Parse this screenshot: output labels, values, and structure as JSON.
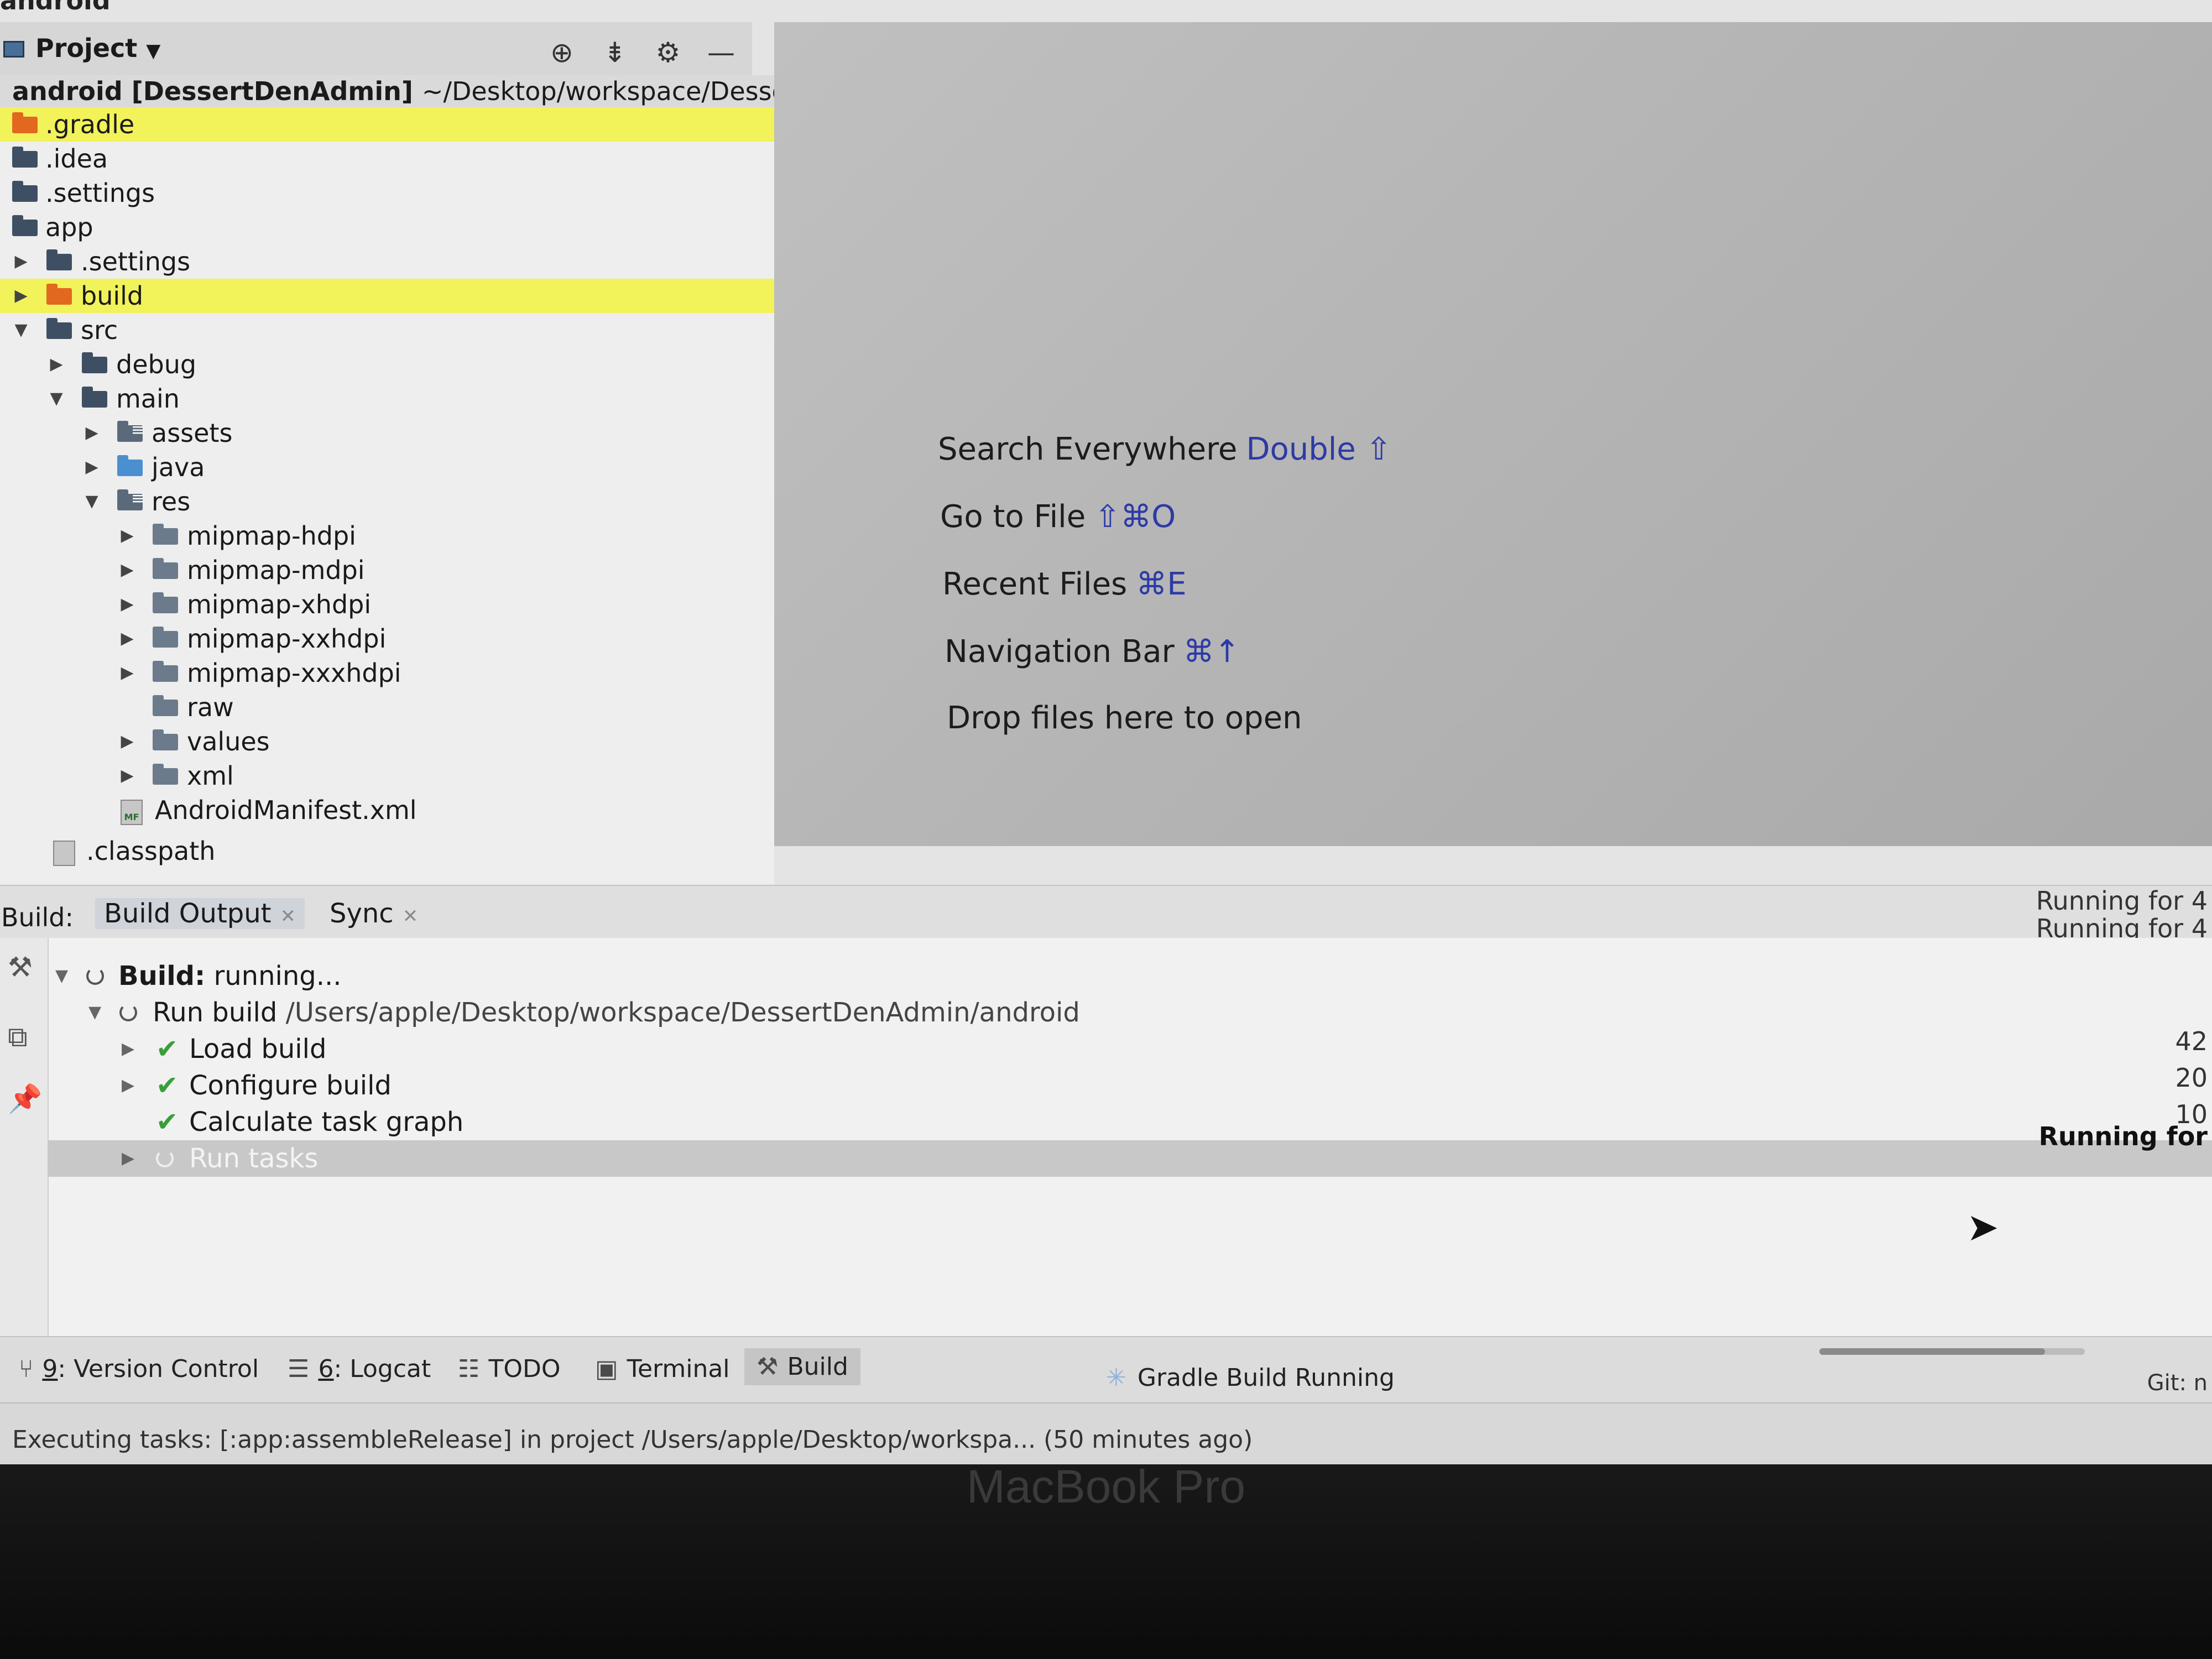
{
  "app_label": "android",
  "project_panel": {
    "title": "Project",
    "caret": "▼",
    "tools": [
      "⊕",
      "⇟",
      "⚙",
      "—"
    ],
    "root_name": "android [DessertDenAdmin]",
    "root_path": "~/Desktop/workspace/DessertDenAdmin/android",
    "items": [
      {
        "label": ".gradle",
        "highlight": true
      },
      {
        "label": ".idea"
      },
      {
        "label": ".settings"
      },
      {
        "label": "app"
      },
      {
        "label": ".settings"
      },
      {
        "label": "build",
        "highlight": true
      },
      {
        "label": "src"
      },
      {
        "label": "debug"
      },
      {
        "label": "main"
      },
      {
        "label": "assets"
      },
      {
        "label": "java"
      },
      {
        "label": "res"
      },
      {
        "label": "mipmap-hdpi"
      },
      {
        "label": "mipmap-mdpi"
      },
      {
        "label": "mipmap-xhdpi"
      },
      {
        "label": "mipmap-xxhdpi"
      },
      {
        "label": "mipmap-xxxhdpi"
      },
      {
        "label": "raw"
      },
      {
        "label": "values"
      },
      {
        "label": "xml"
      },
      {
        "label": "AndroidManifest.xml"
      },
      {
        "label": ".classpath"
      }
    ]
  },
  "editor_hints": [
    {
      "text": "Search Everywhere",
      "shortcut": "Double ⇧"
    },
    {
      "text": "Go to File",
      "shortcut": "⇧⌘O"
    },
    {
      "text": "Recent Files",
      "shortcut": "⌘E"
    },
    {
      "text": "Navigation Bar",
      "shortcut": "⌘↑"
    },
    {
      "text": "Drop files here to open",
      "shortcut": ""
    }
  ],
  "build_window": {
    "label": "Build:",
    "tabs": [
      {
        "label": "Build Output",
        "active": true
      },
      {
        "label": "Sync",
        "active": false
      }
    ],
    "rows": [
      {
        "prefix": "Build:",
        "text": "running..."
      },
      {
        "prefix": "Run build",
        "text": "/Users/apple/Desktop/workspace/DessertDenAdmin/android"
      },
      {
        "prefix": "",
        "text": "Load build"
      },
      {
        "prefix": "",
        "text": "Configure build"
      },
      {
        "prefix": "",
        "text": "Calculate task graph"
      },
      {
        "prefix": "",
        "text": "Run tasks"
      }
    ],
    "right_column": [
      "Running for 4",
      "Running for 4",
      "42",
      "20",
      "10",
      "Running for"
    ]
  },
  "tool_buttons": [
    {
      "icon": "⑂",
      "number": "9",
      "label": ": Version Control"
    },
    {
      "icon": "☰",
      "number": "6",
      "label": ": Logcat"
    },
    {
      "icon": "☷",
      "number": "",
      "label": "TODO"
    },
    {
      "icon": "▣",
      "number": "",
      "label": "Terminal"
    },
    {
      "icon": "⚒",
      "number": "",
      "label": "Build"
    }
  ],
  "gradle_status": "Gradle Build Running",
  "progress": 0.85,
  "git_label": "Git: n",
  "status_text": "Executing tasks: [:app:assembleRelease] in project /Users/apple/Desktop/workspa... (50 minutes ago)",
  "bezel_label": "MacBook Pro",
  "colors": {
    "highlight": "#f2f25a",
    "check": "#3a9e3a",
    "shortcut": "#2d3aa6",
    "orange_folder": "#e2681f"
  }
}
